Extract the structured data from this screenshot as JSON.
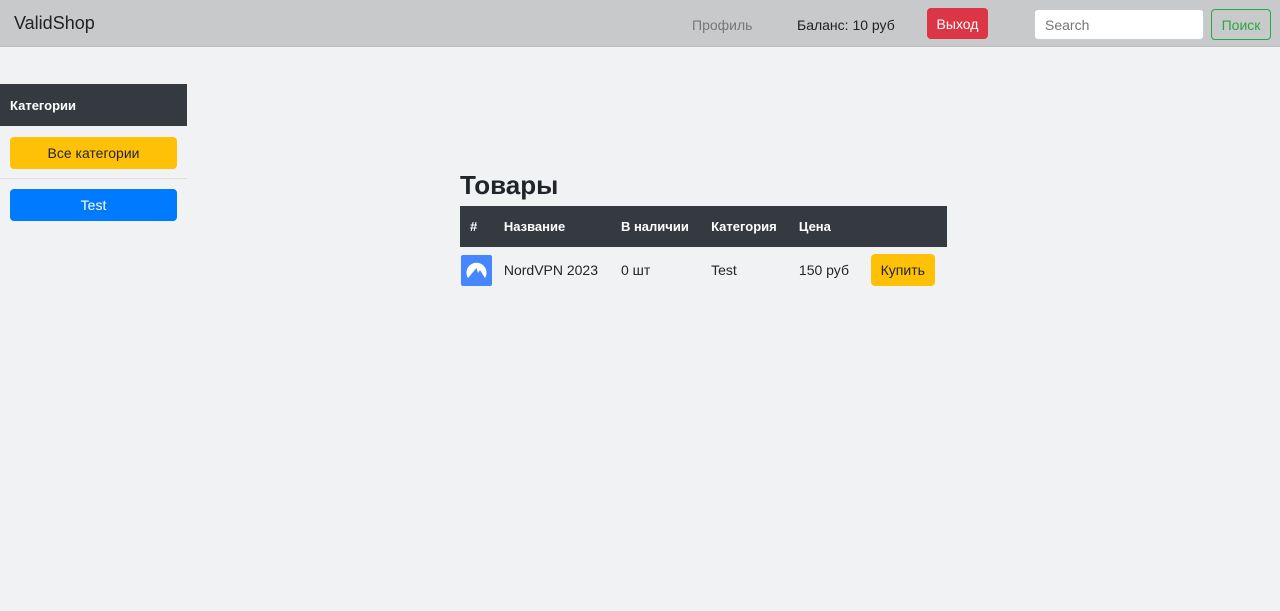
{
  "nav": {
    "brand": "ValidShop",
    "profile": "Профиль",
    "balance": "Баланс: 10 руб",
    "logout": "Выход",
    "search_placeholder": "Search",
    "search_button": "Поиск"
  },
  "sidebar": {
    "title": "Категории",
    "items": [
      {
        "label": "Все категории",
        "color": "#ffc107"
      },
      {
        "label": "Test",
        "color": "#007bff"
      }
    ]
  },
  "main": {
    "title": "Товары",
    "columns": [
      "#",
      "Название",
      "В наличии",
      "Категория",
      "Цена"
    ],
    "rows": [
      {
        "icon": "nordvpn-logo",
        "name": "NordVPN 2023",
        "stock": "0 шт",
        "category": "Test",
        "price": "150 руб",
        "action": "Купить"
      }
    ]
  }
}
